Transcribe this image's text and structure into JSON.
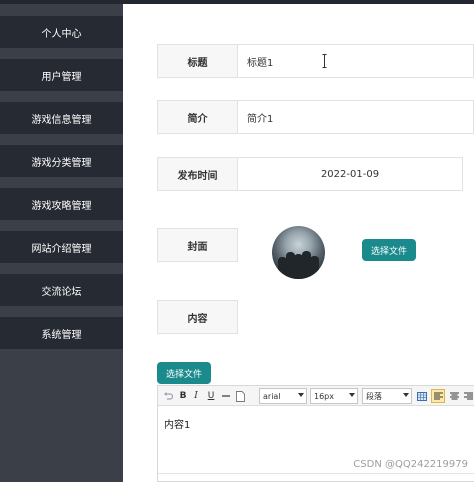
{
  "sidebar": {
    "items": [
      {
        "label": "个人中心"
      },
      {
        "label": "用户管理"
      },
      {
        "label": "游戏信息管理"
      },
      {
        "label": "游戏分类管理"
      },
      {
        "label": "游戏攻略管理"
      },
      {
        "label": "网站介绍管理"
      },
      {
        "label": "交流论坛"
      },
      {
        "label": "系统管理"
      }
    ]
  },
  "form": {
    "title_label": "标题",
    "title_value": "标题1",
    "intro_label": "简介",
    "intro_value": "简介1",
    "publish_label": "发布时间",
    "publish_value": "2022-01-09",
    "cover_label": "封面",
    "cover_upload_label": "选择文件",
    "content_label": "内容",
    "content_upload_label": "选择文件"
  },
  "editor": {
    "toolbar": {
      "bold": "B",
      "italic": "I",
      "underline": "U",
      "font_family": "arial",
      "font_size": "16px",
      "paragraph": "段落"
    },
    "content": "内容1"
  },
  "watermark": "CSDN @QQ242219979",
  "colors": {
    "sidebar_bg": "#3a3f48",
    "nav_item_bg": "#262a33",
    "accent_teal": "#1b8a8c"
  }
}
